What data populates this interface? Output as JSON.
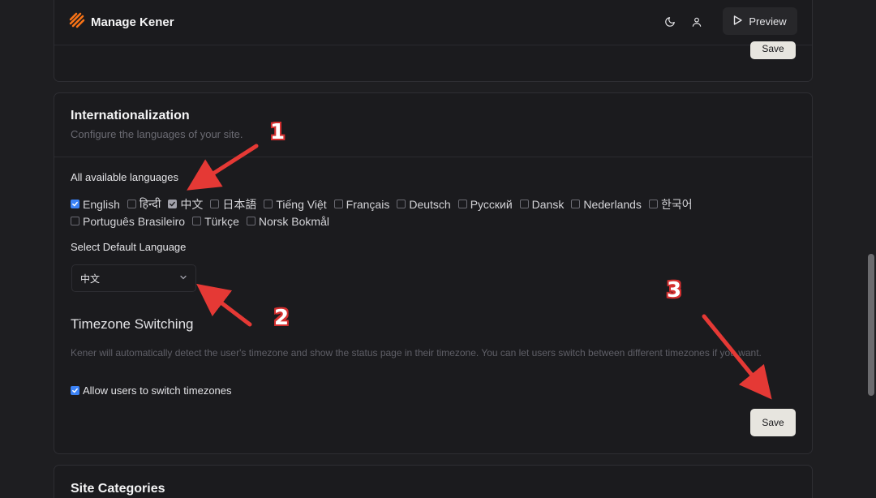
{
  "header": {
    "brand": "Manage Kener",
    "theme_icon": "moon-icon",
    "user_icon": "user-icon",
    "preview_label": "Preview"
  },
  "top_card": {
    "save_label": "Save"
  },
  "internationalization": {
    "title": "Internationalization",
    "description": "Configure the languages of your site.",
    "available_label": "All available languages",
    "languages_row1": [
      {
        "label": "English",
        "checked": true
      },
      {
        "label": "हिन्दी",
        "checked": false
      },
      {
        "label": "中文",
        "checked": true
      },
      {
        "label": "日本語",
        "checked": false
      },
      {
        "label": "Tiếng Việt",
        "checked": false
      },
      {
        "label": "Français",
        "checked": false
      },
      {
        "label": "Deutsch",
        "checked": false
      },
      {
        "label": "Русский",
        "checked": false
      },
      {
        "label": "Dansk",
        "checked": false
      },
      {
        "label": "Nederlands",
        "checked": false
      },
      {
        "label": "한국어",
        "checked": false
      }
    ],
    "languages_row2": [
      {
        "label": "Português Brasileiro",
        "checked": false
      },
      {
        "label": "Türkçe",
        "checked": false
      },
      {
        "label": "Norsk Bokmål",
        "checked": false
      }
    ],
    "default_label": "Select Default Language",
    "default_value": "中文",
    "timezone_title": "Timezone Switching",
    "timezone_description": "Kener will automatically detect the user's timezone and show the status page in their timezone. You can let users switch between different timezones if you want.",
    "timezone_toggle_label": "Allow users to switch timezones",
    "timezone_toggle_checked": true,
    "save_label": "Save"
  },
  "site_categories": {
    "title": "Site Categories"
  },
  "annotations": {
    "n1": "1",
    "n2": "2",
    "n3": "3",
    "color": "#e53935"
  },
  "colors": {
    "accent": "#3b82f6",
    "background": "#1e1e21",
    "card": "#1b1b1e",
    "save_bg": "#e7e5df"
  }
}
